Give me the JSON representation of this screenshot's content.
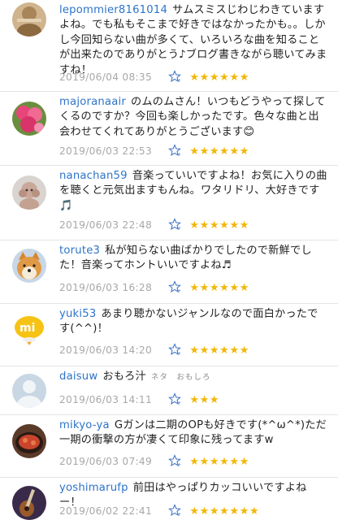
{
  "comments": [
    {
      "user": "lepommier8161014",
      "text": "サムスミスじわじわきていますよね。でも私もそこまで好きではなかったかも。。しかし今回知らない曲が多くて、いろいろな曲を知ることが出来たのでありがとう♪ブログ書きながら聴いてみますね！",
      "date": "2019/06/04 08:35",
      "stars": "★★★★★★",
      "avatar": "sepia-doll-icon"
    },
    {
      "user": "majoranaair",
      "text": "のムのムさん！いつもどうやって探してくるのですか？今回も楽しかったです。色々な曲と出会わせてくれてありがとうございます😊",
      "date": "2019/06/03 22:53",
      "stars": "★★★★★★",
      "avatar": "pink-flowers-icon"
    },
    {
      "user": "nanachan59",
      "text": "音楽っていいですよね！お気に入りの曲を聴くと元気出ますもんね。ワタリドリ、大好きです🎵",
      "date": "2019/06/03 22:48",
      "stars": "★★★★★★",
      "avatar": "poodle-dog-icon"
    },
    {
      "user": "torute3",
      "text": "私が知らない曲ばかりでしたので新鮮でした！音楽ってホントいいですよね♬",
      "date": "2019/06/03 16:28",
      "stars": "★★★★★★",
      "avatar": "shiba-dog-icon"
    },
    {
      "user": "yuki53",
      "text": "あまり聴かないジャンルなので面白かったです(^^)！",
      "date": "2019/06/03 14:20",
      "stars": "★★★★★★",
      "avatar": "yellow-chick-icon"
    },
    {
      "user": "daisuw",
      "text": "おもろ汁",
      "tags": "ネタ　おもしろ",
      "date": "2019/06/03 14:11",
      "stars": "★★★",
      "avatar": "default-user-icon"
    },
    {
      "user": "mikyo-ya",
      "text": "Gガンは二期のOPも好きです(*^ω^*)ただ一期の衝撃の方が凄くて印象に残ってますw",
      "date": "2019/06/03 07:49",
      "stars": "★★★★★★",
      "avatar": "food-dish-icon"
    },
    {
      "user": "yoshimarufp",
      "text": "前田はやっぱりカッコいいですよねー！",
      "date": "2019/06/02 22:41",
      "stars": "★★★★★★★",
      "avatar": "guitar-icon"
    }
  ]
}
